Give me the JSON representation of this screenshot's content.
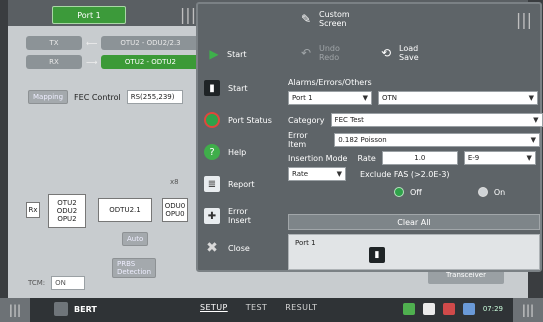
{
  "app": {
    "port_tab": "Port 1",
    "path": {
      "r1_left": "TX",
      "r1_right": "OTU2 - ODU2/2.3",
      "r2_left": "RX",
      "r2_right": "OTU2 - ODTU2"
    },
    "fec": {
      "mapping_button": "Mapping",
      "label": "FEC Control",
      "value": "RS(255,239)"
    },
    "diagram": {
      "rx": "Rx",
      "box1": "OTU2\nODU2\nOPU2",
      "box2": "ODTU2.1",
      "box3": "ODU0\nOPU0",
      "x_label": "x8",
      "auto": "Auto",
      "prbs": "PRBS\nDetection"
    },
    "tcm": {
      "label": "TCM:",
      "value": "ON"
    },
    "transceiver": "Transceiver"
  },
  "panel": {
    "top": {
      "custom_screen": "Custom\nScreen",
      "undo_redo": "Undo\nRedo",
      "load_save": "Load\nSave",
      "start": "Start"
    },
    "side_menu": [
      {
        "label": "Start",
        "icon": "stoplight-icon"
      },
      {
        "label": "Port Status",
        "icon": "port-status-icon"
      },
      {
        "label": "Help",
        "icon": "help-icon"
      },
      {
        "label": "Report",
        "icon": "report-icon"
      },
      {
        "label": "Error\nInsert",
        "icon": "error-insert-icon"
      },
      {
        "label": "Close",
        "icon": "close-icon"
      }
    ],
    "form": {
      "section_title": "Alarms/Errors/Others",
      "port_select": "Port 1",
      "otn_select": "OTN",
      "category_label": "Category",
      "category_value": "FEC Test",
      "error_item_label": "Error Item",
      "error_item_value": "0.182 Poisson",
      "insertion_mode_label": "Insertion Mode",
      "insertion_mode_value": "Rate",
      "rate_label": "Rate",
      "rate_value": "1.0",
      "rate_exp": "E-9",
      "exclude_fas_label": "Exclude FAS (>2.0E-3)",
      "radio_off": "Off",
      "radio_on": "On",
      "clear_all": "Clear All",
      "port_box": "Port 1"
    }
  },
  "bottom": {
    "bert": "BERT",
    "tabs": [
      "SETUP",
      "TEST",
      "RESULT"
    ],
    "time": "07:29"
  }
}
